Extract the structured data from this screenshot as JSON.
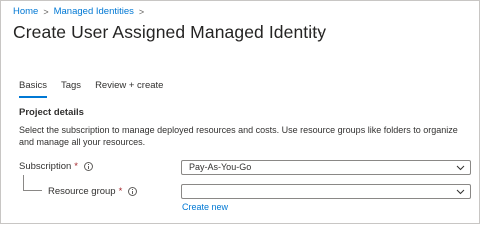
{
  "breadcrumb": {
    "items": [
      "Home",
      "Managed Identities"
    ],
    "separator": ">"
  },
  "page": {
    "title": "Create User Assigned Managed Identity",
    "more_label": "···"
  },
  "tabs": [
    {
      "label": "Basics",
      "active": true
    },
    {
      "label": "Tags",
      "active": false
    },
    {
      "label": "Review + create",
      "active": false
    }
  ],
  "project_details": {
    "heading": "Project details",
    "description": "Select the subscription to manage deployed resources and costs. Use resource groups like folders to organize and manage all your resources."
  },
  "subscription": {
    "label": "Subscription",
    "required_mark": "*",
    "value": "Pay-As-You-Go"
  },
  "resource_group": {
    "label": "Resource group",
    "required_mark": "*",
    "value": "",
    "create_new_label": "Create new"
  },
  "colors": {
    "accent": "#0078d4",
    "required": "#a4262c",
    "text": "#323130"
  }
}
